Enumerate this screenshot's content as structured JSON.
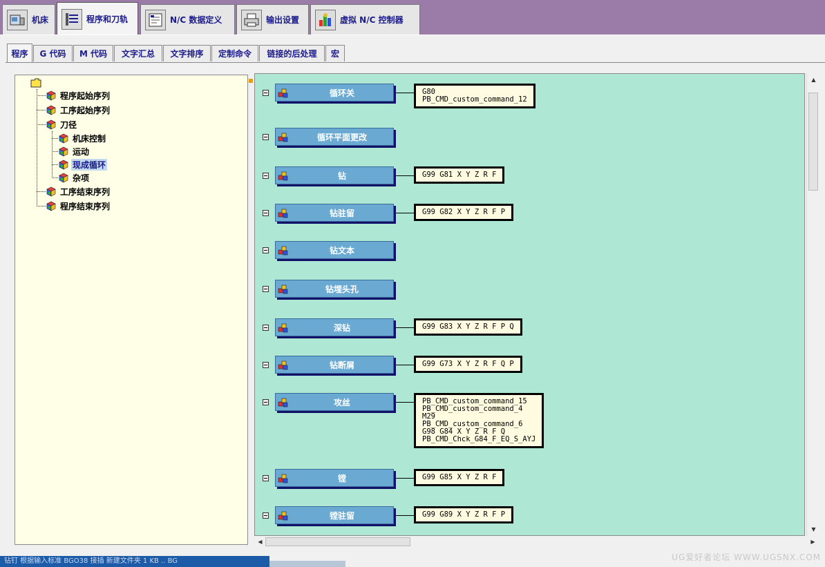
{
  "top_tabs": [
    {
      "label": "机床",
      "icon": "machine-icon",
      "active": false
    },
    {
      "label": "程序和刀轨",
      "icon": "toolpath-icon",
      "active": true
    },
    {
      "label": "N/C 数据定义",
      "icon": "nc-data-icon",
      "active": false
    },
    {
      "label": "输出设置",
      "icon": "printer-icon",
      "active": false
    },
    {
      "label": "虚拟 N/C 控制器",
      "icon": "controller-icon",
      "active": false
    }
  ],
  "sub_tabs": [
    {
      "label": "程序",
      "active": true
    },
    {
      "label": "G 代码",
      "active": false
    },
    {
      "label": "M 代码",
      "active": false
    },
    {
      "label": "文字汇总",
      "active": false
    },
    {
      "label": "文字排序",
      "active": false
    },
    {
      "label": "定制命令",
      "active": false
    },
    {
      "label": "链接的后处理",
      "active": false
    },
    {
      "label": "宏",
      "active": false
    }
  ],
  "tree": {
    "root_icon": "folder-icon",
    "items": [
      {
        "label": "程序起始序列",
        "level": 1,
        "selected": false
      },
      {
        "label": "工序起始序列",
        "level": 1,
        "selected": false
      },
      {
        "label": "刀径",
        "level": 1,
        "selected": false
      },
      {
        "label": "机床控制",
        "level": 2,
        "selected": false
      },
      {
        "label": "运动",
        "level": 2,
        "selected": false
      },
      {
        "label": "现成循环",
        "level": 2,
        "selected": true
      },
      {
        "label": "杂项",
        "level": 2,
        "selected": false
      },
      {
        "label": "工序结束序列",
        "level": 1,
        "selected": false
      },
      {
        "label": "程序结束序列",
        "level": 1,
        "selected": false
      }
    ]
  },
  "events": [
    {
      "label": "循环关",
      "commands": "G80\nPB_CMD_custom_command_12"
    },
    {
      "label": "循环平面更改",
      "commands": ""
    },
    {
      "label": "钻",
      "commands": "G99 G81 X Y Z R F"
    },
    {
      "label": "钻驻留",
      "commands": "G99 G82 X Y Z R F P"
    },
    {
      "label": "钻文本",
      "commands": ""
    },
    {
      "label": "钻埋头孔",
      "commands": ""
    },
    {
      "label": "深钻",
      "commands": "G99 G83 X Y Z R F P Q"
    },
    {
      "label": "钻断屑",
      "commands": "G99 G73 X Y Z R F Q P"
    },
    {
      "label": "攻丝",
      "commands": "PB_CMD_custom_command_15\nPB_CMD_custom_command_4\nM29\nPB_CMD_custom_command_6\nG98 G84 X Y Z R F Q\nPB_CMD_Chck_G84_F_EQ_S_AYJ"
    },
    {
      "label": "镗",
      "commands": "G99 G85 X Y Z R F"
    },
    {
      "label": "镗驻留",
      "commands": "G99 G89 X Y Z R F P"
    }
  ],
  "taskbar": {
    "text": "钻钉    根据输入标准 BGO38 接插  新建文件夹    1 KB .. BG"
  },
  "watermark": "UG爱好者论坛 WWW.UGSNX.COM",
  "colors": {
    "top_bar": "#9b7ba7",
    "canvas": "#aee8d4",
    "event_button": "#6aaad2",
    "tree_bg": "#ffffe8"
  }
}
